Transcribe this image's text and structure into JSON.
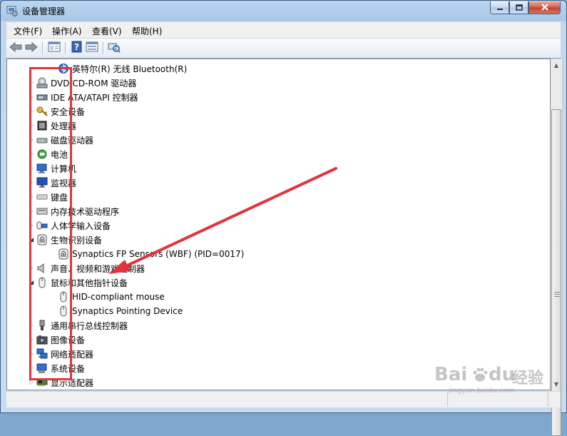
{
  "window": {
    "title": "设备管理器",
    "caption_buttons": {
      "minimize": "minimize-icon",
      "maximize": "maximize-icon",
      "close": "close-icon"
    }
  },
  "menu": {
    "items": [
      {
        "label": "文件(F)"
      },
      {
        "label": "操作(A)"
      },
      {
        "label": "查看(V)"
      },
      {
        "label": "帮助(H)"
      }
    ]
  },
  "toolbar": {
    "buttons": [
      "back-arrow-icon",
      "forward-arrow-icon",
      "properties-icon",
      "help-icon",
      "device-view-icon",
      "scan-hardware-icon"
    ]
  },
  "tree": {
    "items": [
      {
        "label": "英特尔(R) 无线 Bluetooth(R)",
        "level": 1,
        "icon": "bluetooth-icon"
      },
      {
        "label": "DVD/CD-ROM 驱动器",
        "level": 0,
        "icon": "dvd-drive-icon"
      },
      {
        "label": "IDE ATA/ATAPI 控制器",
        "level": 0,
        "icon": "ide-controller-icon"
      },
      {
        "label": "安全设备",
        "level": 0,
        "icon": "security-key-icon"
      },
      {
        "label": "处理器",
        "level": 0,
        "icon": "processor-icon"
      },
      {
        "label": "磁盘驱动器",
        "level": 0,
        "icon": "disk-drive-icon"
      },
      {
        "label": "电池",
        "level": 0,
        "icon": "battery-icon"
      },
      {
        "label": "计算机",
        "level": 0,
        "icon": "computer-icon"
      },
      {
        "label": "监视器",
        "level": 0,
        "icon": "monitor-icon"
      },
      {
        "label": "键盘",
        "level": 0,
        "icon": "keyboard-icon"
      },
      {
        "label": "内存技术驱动程序",
        "level": 0,
        "icon": "memory-tech-icon"
      },
      {
        "label": "人体学输入设备",
        "level": 0,
        "icon": "hid-icon"
      },
      {
        "label": "生物识别设备",
        "level": 0,
        "icon": "biometric-icon"
      },
      {
        "label": "Synaptics FP Sensors (WBF) (PID=0017)",
        "level": 1,
        "icon": "fingerprint-icon"
      },
      {
        "label": "声音、视频和游戏控制器",
        "level": 0,
        "icon": "speaker-icon"
      },
      {
        "label": "鼠标和其他指针设备",
        "level": 0,
        "icon": "mouse-icon",
        "expanded": true
      },
      {
        "label": "HID-compliant mouse",
        "level": 1,
        "icon": "mouse-icon"
      },
      {
        "label": "Synaptics Pointing Device",
        "level": 1,
        "icon": "mouse-icon"
      },
      {
        "label": "通用串行总线控制器",
        "level": 0,
        "icon": "usb-icon"
      },
      {
        "label": "图像设备",
        "level": 0,
        "icon": "camera-icon"
      },
      {
        "label": "网络适配器",
        "level": 0,
        "icon": "network-icon"
      },
      {
        "label": "系统设备",
        "level": 0,
        "icon": "system-device-icon"
      },
      {
        "label": "显示适配器",
        "level": 0,
        "icon": "display-adapter-icon"
      }
    ]
  },
  "annotation": {
    "color": "#e0353e"
  },
  "watermark": {
    "brand": "Bai",
    "paw": "paw-icon",
    "brand2": "du",
    "cn": "经验",
    "url": "jingyan.baidu.com"
  }
}
